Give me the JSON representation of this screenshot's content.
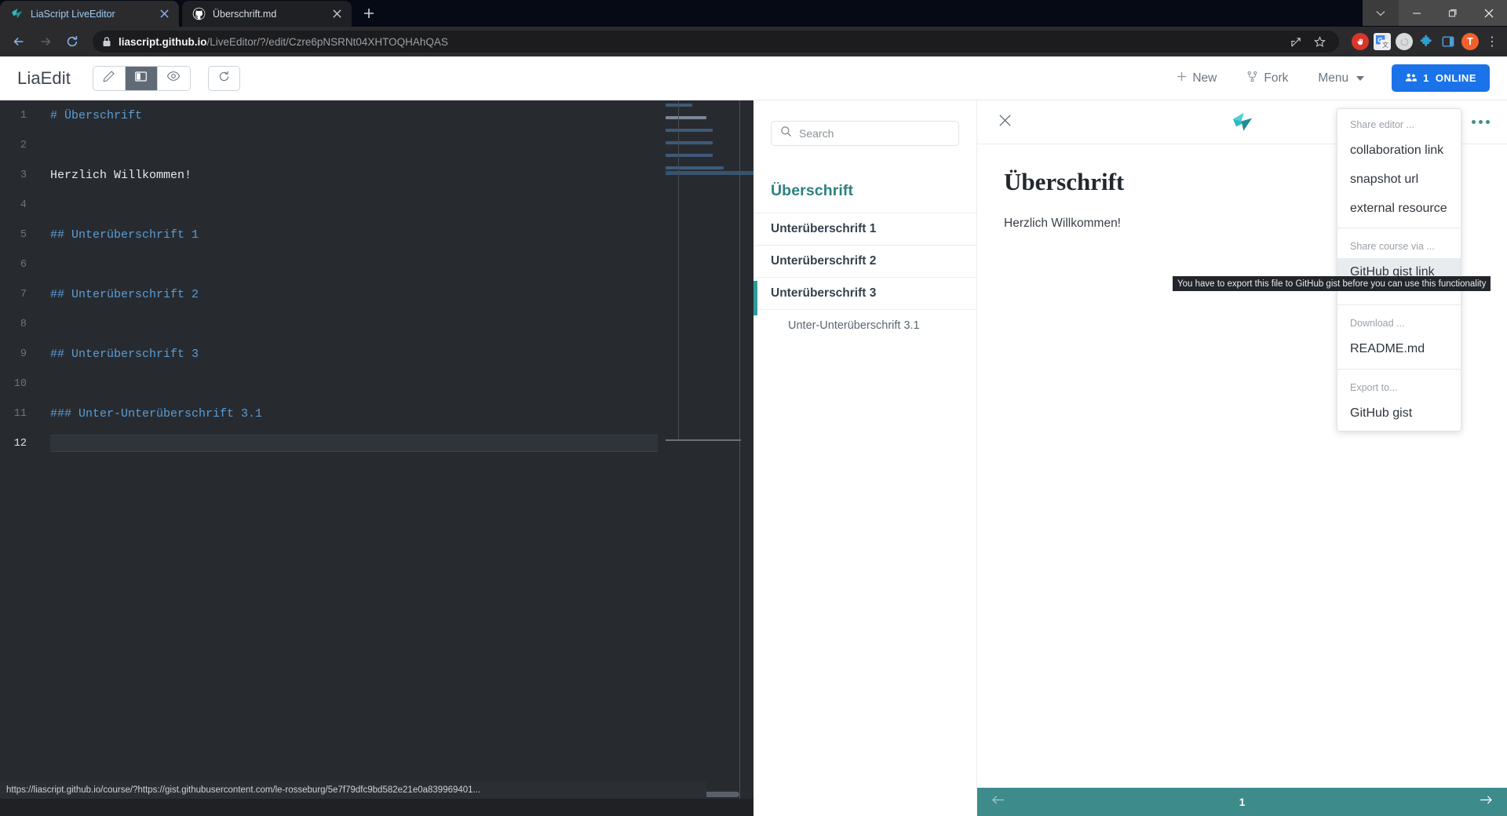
{
  "browser": {
    "tabs": [
      {
        "title": "LiaScript LiveEditor",
        "favicon": "liascript-bird-icon",
        "active": true
      },
      {
        "title": "Überschrift.md",
        "favicon": "github-icon",
        "active": false
      }
    ],
    "new_tab_label": "+",
    "window_controls": [
      "tab-search-icon",
      "minimize-icon",
      "maximize-icon",
      "close-icon"
    ],
    "nav": {
      "back": "back-icon",
      "forward": "forward-icon",
      "reload": "reload-icon"
    },
    "omnibox": {
      "lock": "lock-icon",
      "url_domain": "liascript.github.io",
      "url_path": "/LiveEditor/?/edit/Czre6pNSRNt04XHTOQHAhQAS",
      "share_icon": "share-icon",
      "bookmark_icon": "star-icon"
    },
    "extensions": [
      {
        "name": "adblock-icon",
        "label": ""
      },
      {
        "name": "google-translate-icon",
        "label": "G"
      },
      {
        "name": "extension-gray-icon",
        "label": ""
      },
      {
        "name": "extensions-puzzle-icon",
        "label": ""
      },
      {
        "name": "browser-sidebar-icon",
        "label": ""
      },
      {
        "name": "profile-avatar",
        "label": "T"
      },
      {
        "name": "browser-menu-icon",
        "label": "⋮"
      }
    ],
    "status_bar_url": "https://liascript.github.io/course/?https://gist.githubusercontent.com/le-rosseburg/5e7f79dfc9bd582e21e0a839969401..."
  },
  "app_header": {
    "logo": "LiaEdit",
    "view_modes": [
      {
        "name": "edit-mode",
        "icon": "pencil-icon",
        "active": false
      },
      {
        "name": "split-mode",
        "icon": "columns-icon",
        "active": true
      },
      {
        "name": "preview-mode",
        "icon": "eye-icon",
        "active": false
      }
    ],
    "reload_button": {
      "icon": "refresh-icon",
      "label": ""
    },
    "new_label": "New",
    "fork_label": "Fork",
    "menu_label": "Menu",
    "online_count": "1",
    "online_label": "ONLINE"
  },
  "editor": {
    "lines": [
      {
        "no": "1",
        "text": "# Überschrift",
        "kind": "heading"
      },
      {
        "no": "2",
        "text": "",
        "kind": "empty"
      },
      {
        "no": "3",
        "text": "Herzlich Willkommen!",
        "kind": "text"
      },
      {
        "no": "4",
        "text": "",
        "kind": "empty"
      },
      {
        "no": "5",
        "text": "## Unterüberschrift 1",
        "kind": "heading"
      },
      {
        "no": "6",
        "text": "",
        "kind": "empty"
      },
      {
        "no": "7",
        "text": "## Unterüberschrift 2",
        "kind": "heading"
      },
      {
        "no": "8",
        "text": "",
        "kind": "empty"
      },
      {
        "no": "9",
        "text": "## Unterüberschrift 3",
        "kind": "heading"
      },
      {
        "no": "10",
        "text": "",
        "kind": "empty"
      },
      {
        "no": "11",
        "text": "### Unter-Unterüberschrift 3.1",
        "kind": "heading"
      },
      {
        "no": "12",
        "text": "",
        "kind": "active"
      }
    ]
  },
  "toc": {
    "search_placeholder": "Search",
    "search_icon": "search-icon",
    "title": "Überschrift",
    "items": [
      {
        "label": "Unterüberschrift 1",
        "sub": false
      },
      {
        "label": "Unterüberschrift 2",
        "sub": false
      },
      {
        "label": "Unterüberschrift 3",
        "sub": false
      },
      {
        "label": "Unter-Unterüberschrift 3.1",
        "sub": true
      }
    ]
  },
  "course": {
    "close_icon": "close-icon",
    "logo": "liascript-bird-icon",
    "options_icon": "more-options-icon",
    "heading": "Überschrift",
    "paragraph": "Herzlich Willkommen!",
    "footer": {
      "prev_icon": "arrow-left-icon",
      "page": "1",
      "next_icon": "arrow-right-icon"
    }
  },
  "menu": {
    "groups": [
      {
        "label": "Share editor ...",
        "items": [
          {
            "text": "collaboration link",
            "highlighted": false
          },
          {
            "text": "snapshot url",
            "highlighted": false
          },
          {
            "text": "external resource",
            "highlighted": false
          }
        ]
      },
      {
        "label": "Share course via ...",
        "items": [
          {
            "text": "GitHub gist link",
            "highlighted": true
          },
          {
            "text": "",
            "highlighted": false
          }
        ]
      },
      {
        "label": "Download ...",
        "items": [
          {
            "text": "README.md",
            "highlighted": false
          }
        ]
      },
      {
        "label": "Export to...",
        "items": [
          {
            "text": "GitHub gist",
            "highlighted": false
          }
        ]
      }
    ],
    "tooltip": "You have to export this file to GitHub gist before you can use this functionality"
  },
  "colors": {
    "accent_teal": "#2e9b9b",
    "footer_teal": "#3d8b8b",
    "online_blue": "#1a73e8",
    "editor_bg": "#272b30",
    "code_heading": "#5b9cd6"
  }
}
